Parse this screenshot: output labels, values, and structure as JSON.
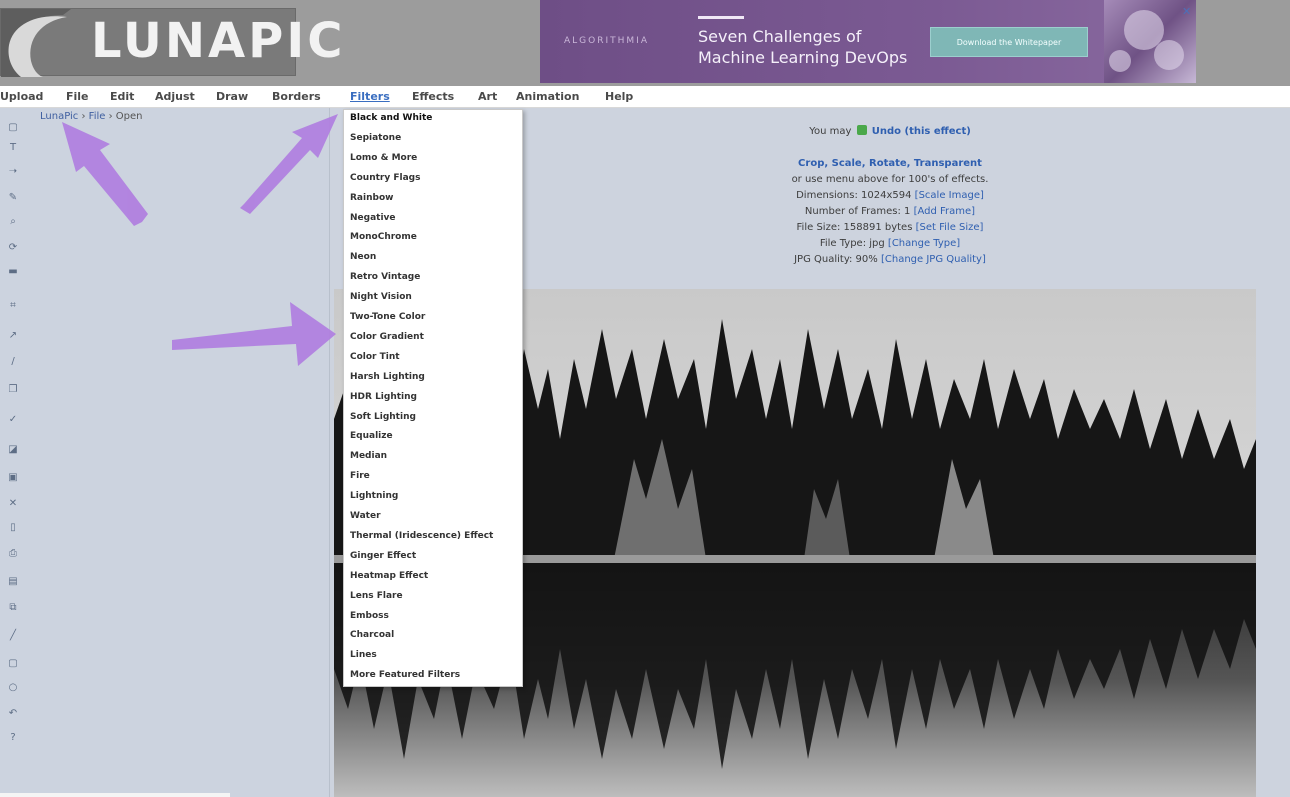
{
  "header": {
    "logo_text": "LUNAPIC",
    "ad": {
      "brand": "ALGORITHMIA",
      "headline_line1": "Seven Challenges of",
      "headline_line2": "Machine Learning DevOps",
      "cta": "Download the Whitepaper",
      "close_glyph": "✕"
    }
  },
  "menu": {
    "items": [
      "Upload",
      "File",
      "Edit",
      "Adjust",
      "Draw",
      "Borders",
      "Filters",
      "Effects",
      "Art",
      "Animation",
      "Help"
    ],
    "active": "Filters"
  },
  "breadcrumb": {
    "home": "LunaPic",
    "sep": "›",
    "section": "File",
    "current": "Open"
  },
  "info": {
    "undo_prefix": "You may",
    "undo_link": "Undo (this effect)",
    "crop_link": "Crop, Scale, Rotate, Transparent",
    "menu_hint": "or use menu above for 100's of effects.",
    "dimensions_text": "Dimensions: 1024x594",
    "scale_link": "[Scale Image]",
    "frames_text": "Number of Frames: 1",
    "add_frame_link": "[Add Frame]",
    "filesize_text": "File Size: 158891 bytes",
    "set_filesize_link": "[Set File Size]",
    "filetype_text": "File Type: jpg",
    "change_type_link": "[Change Type]",
    "jpg_quality_text": "JPG Quality: 90%",
    "change_quality_link": "[Change JPG Quality]"
  },
  "filters_menu": {
    "items": [
      "Black and White",
      "Sepiatone",
      "Lomo & More",
      "Country Flags",
      "Rainbow",
      "Negative",
      "MonoChrome",
      "Neon",
      "Retro Vintage",
      "Night Vision",
      "Two-Tone Color",
      "Color Gradient",
      "Color Tint",
      "Harsh Lighting",
      "HDR Lighting",
      "Soft Lighting",
      "Equalize",
      "Median",
      "Fire",
      "Lightning",
      "Water",
      "Thermal (Iridescence) Effect",
      "Ginger Effect",
      "Heatmap Effect",
      "Lens Flare",
      "Emboss",
      "Charcoal",
      "Lines",
      "More Featured Filters"
    ]
  },
  "colors": {
    "accent_link": "#2f5fb0",
    "annotation_arrow": "#b07ee0",
    "ad_background": "#7b5a93"
  }
}
